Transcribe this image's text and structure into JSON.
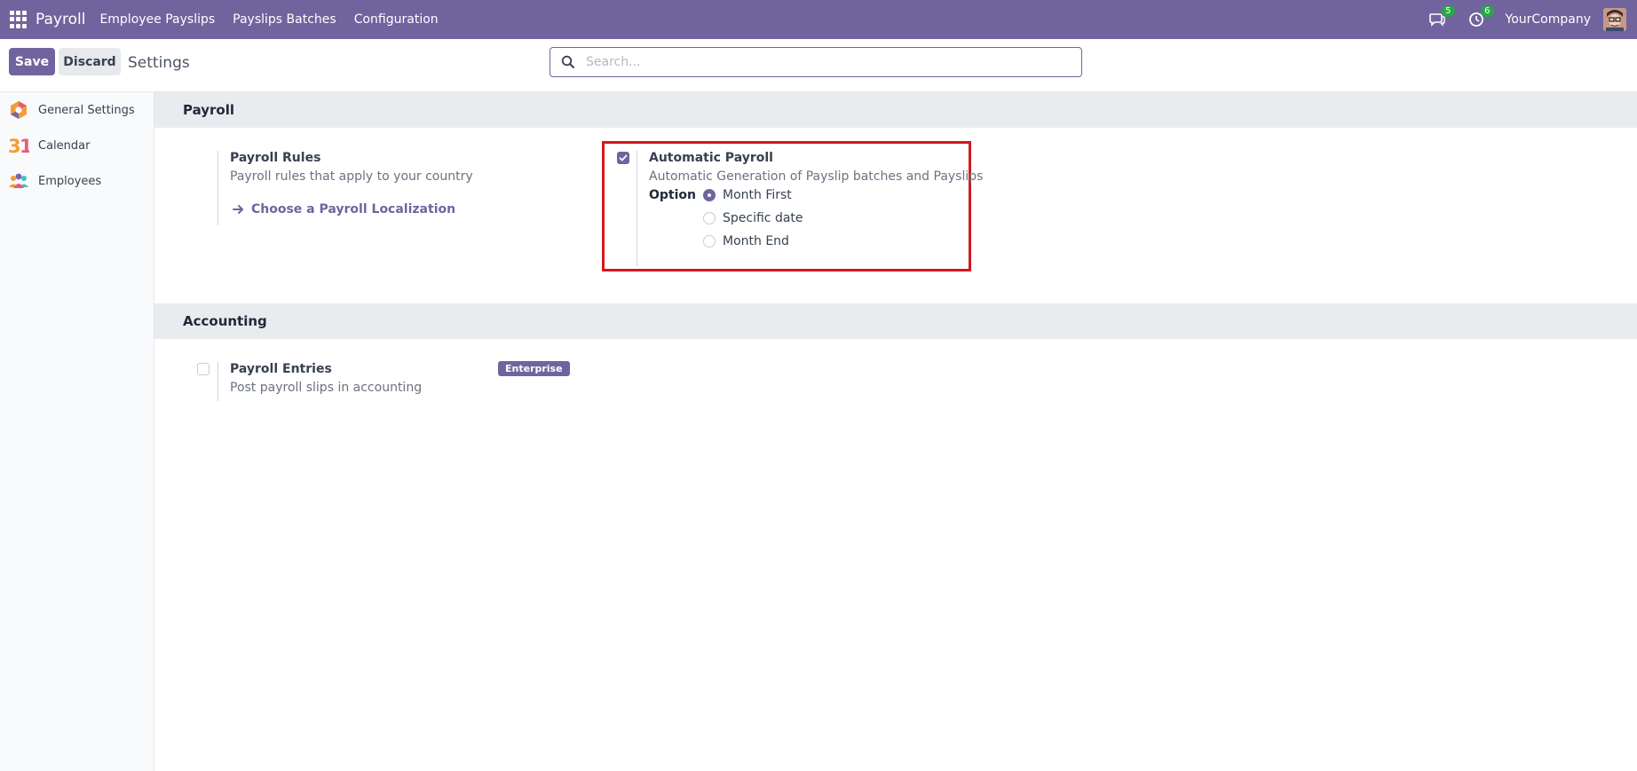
{
  "navbar": {
    "brand": "Payroll",
    "menu": [
      "Employee Payslips",
      "Payslips Batches",
      "Configuration"
    ],
    "messages_count": "5",
    "activities_count": "6",
    "company": "YourCompany",
    "bg_color": "#71639e"
  },
  "control": {
    "save_label": "Save",
    "discard_label": "Discard",
    "title": "Settings",
    "search_placeholder": "Search..."
  },
  "sidebar": {
    "items": [
      {
        "label": "General Settings",
        "icon": "odoo-settings-icon"
      },
      {
        "label": "Calendar",
        "icon": "calendar-31-icon"
      },
      {
        "label": "Employees",
        "icon": "employees-icon"
      }
    ]
  },
  "payroll_section": {
    "title": "Payroll",
    "rules": {
      "title": "Payroll Rules",
      "desc": "Payroll rules that apply to your country",
      "link": "Choose a Payroll Localization"
    },
    "automatic": {
      "title": "Automatic Payroll",
      "desc": "Automatic Generation of Payslip batches and Payslips",
      "checked": true,
      "option_label": "Option",
      "options": [
        "Month First",
        "Specific date",
        "Month End"
      ],
      "selected_option": "Month First"
    }
  },
  "accounting_section": {
    "title": "Accounting",
    "entries": {
      "title": "Payroll Entries",
      "desc": "Post payroll slips in accounting",
      "checked": false,
      "badge": "Enterprise"
    }
  }
}
